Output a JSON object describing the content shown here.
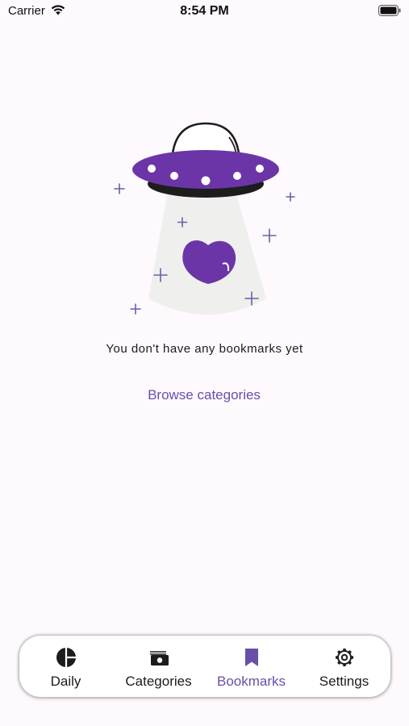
{
  "status_bar": {
    "carrier": "Carrier",
    "time": "8:54 PM"
  },
  "empty_state": {
    "illustration": "ufo-heart-illustration",
    "message": "You don't have any bookmarks yet",
    "browse_link": "Browse categories"
  },
  "bottom_nav": {
    "active": "Bookmarks",
    "items": [
      {
        "label": "Daily",
        "icon": "pie-chart-icon"
      },
      {
        "label": "Categories",
        "icon": "money-icon"
      },
      {
        "label": "Bookmarks",
        "icon": "bookmark-icon"
      },
      {
        "label": "Settings",
        "icon": "gear-icon"
      }
    ]
  },
  "colors": {
    "accent": "#6a4fa8",
    "ufo_purple": "#6b35a8",
    "background": "#fdf9fd"
  }
}
